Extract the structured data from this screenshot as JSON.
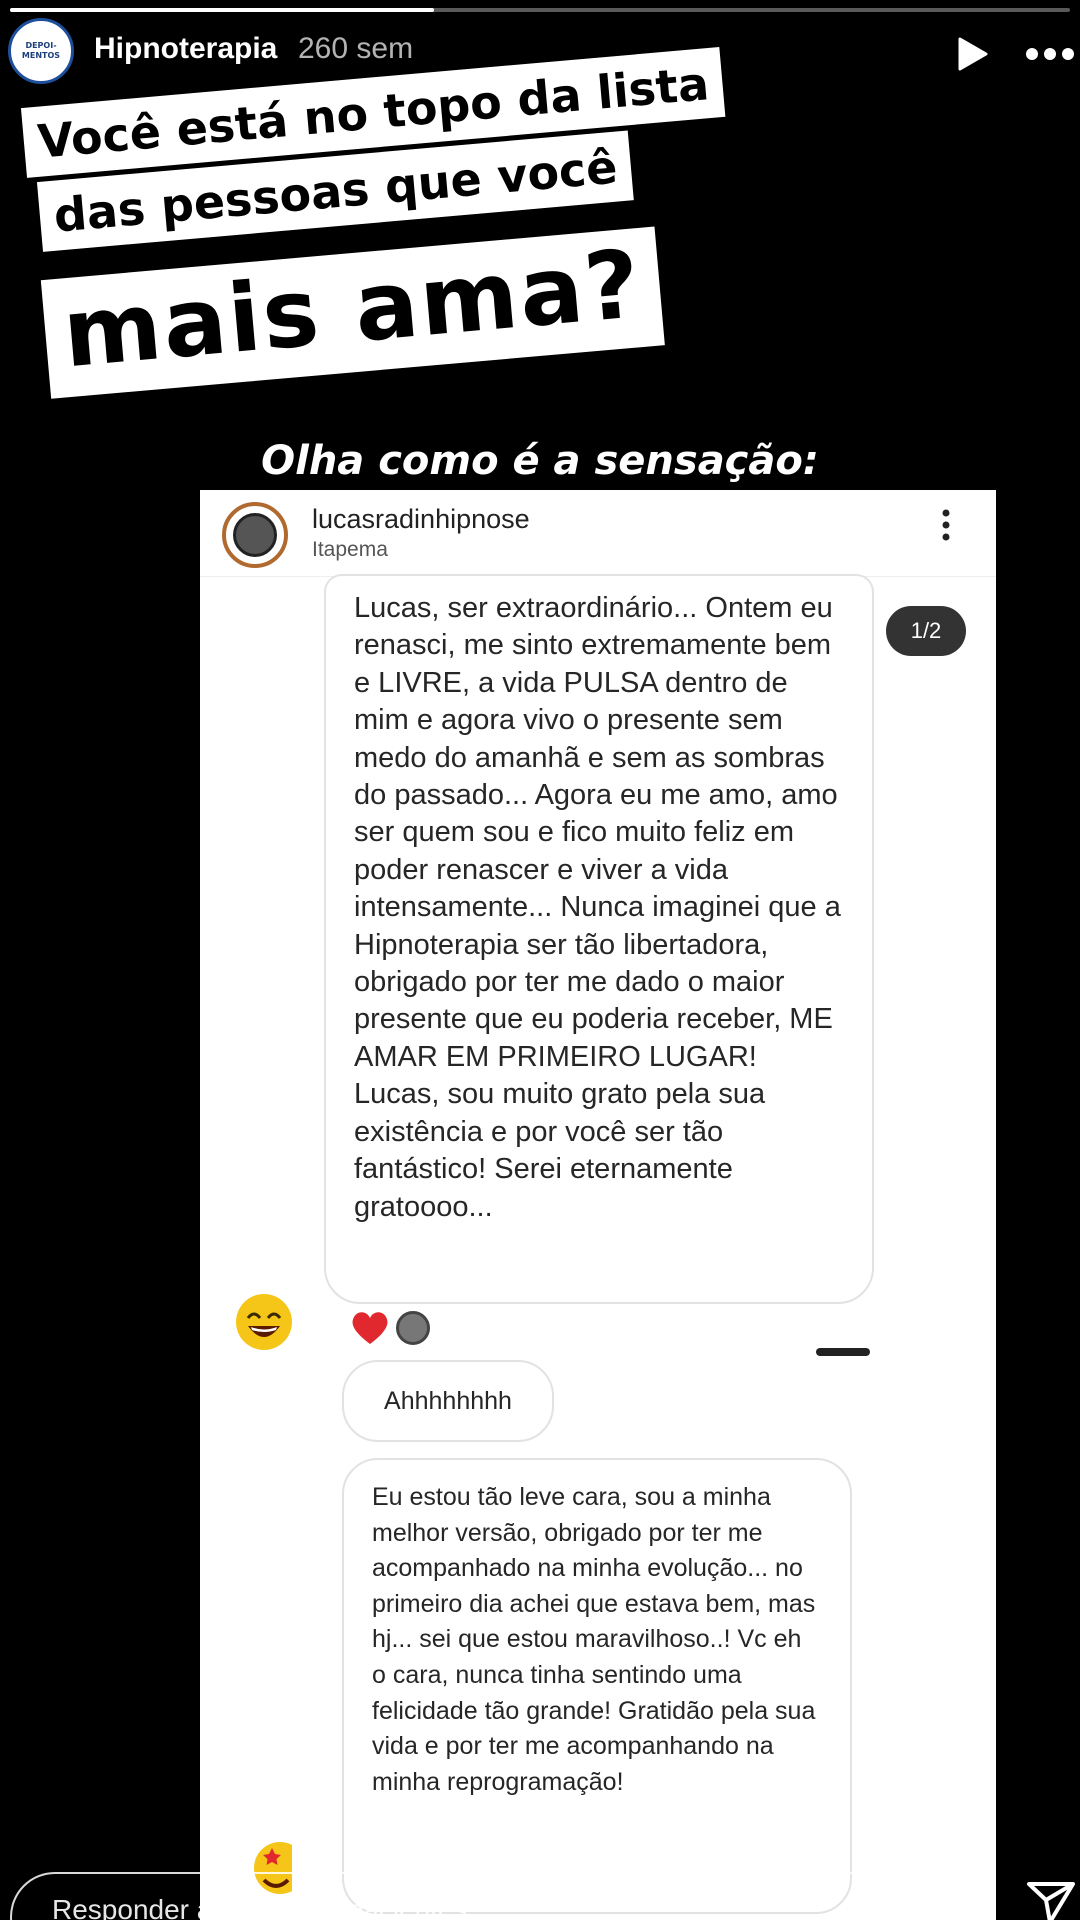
{
  "header": {
    "avatar_text": "DEPOI-MENTOS",
    "username": "Hipnoterapia",
    "time": "260 sem",
    "play_icon": "play-icon",
    "more_icon": "more-icon"
  },
  "title": {
    "line1": "Você está no topo da lista",
    "line2": "das pessoas que você",
    "line3": "mais ama?"
  },
  "caption": "Olha como é a sensação:",
  "screenshot": {
    "username": "lucasradinhipnose",
    "location": "Itapema",
    "counter": "1/2",
    "message1": "Lucas, ser extraordinário... Ontem eu renasci, me sinto extremamente bem e LIVRE, a vida PULSA dentro de mim e agora vivo o presente sem medo do amanhã e sem as sombras do passado... Agora eu me amo, amo ser quem sou e fico muito feliz em poder renascer e viver a vida intensamente... Nunca imaginei que a Hipnoterapia ser tão libertadora, obrigado por ter me dado o maior presente que eu poderia receber, ME AMAR EM PRIMEIRO LUGAR! Lucas, sou muito grato pela sua existência e por você ser tão fantástico! Serei eternamente gratoooo...",
    "message2": "Ahhhhhhhh",
    "message3": "Eu estou tão leve cara, sou a minha melhor versão, obrigado por ter me acompanhado na minha evolução... no primeiro dia achei que estava bem, mas hj... sei que estou maravilhoso..! Vc eh o cara, nunca tinha sentindo uma felicidade tão grande! Gratidão pela sua vida e por ter me acompanhando na minha reprogramação!"
  },
  "reply": {
    "placeholder": "Responder a lucasradinpacientes"
  },
  "icons": [
    "play-icon",
    "more-icon",
    "heart-icon",
    "like-icon",
    "send-icon",
    "laughing-emoji-icon",
    "star-eyes-emoji-icon"
  ],
  "colors": {
    "background": "#000000",
    "heart": "#e0282e",
    "avatar_border": "#1d4f9a"
  }
}
